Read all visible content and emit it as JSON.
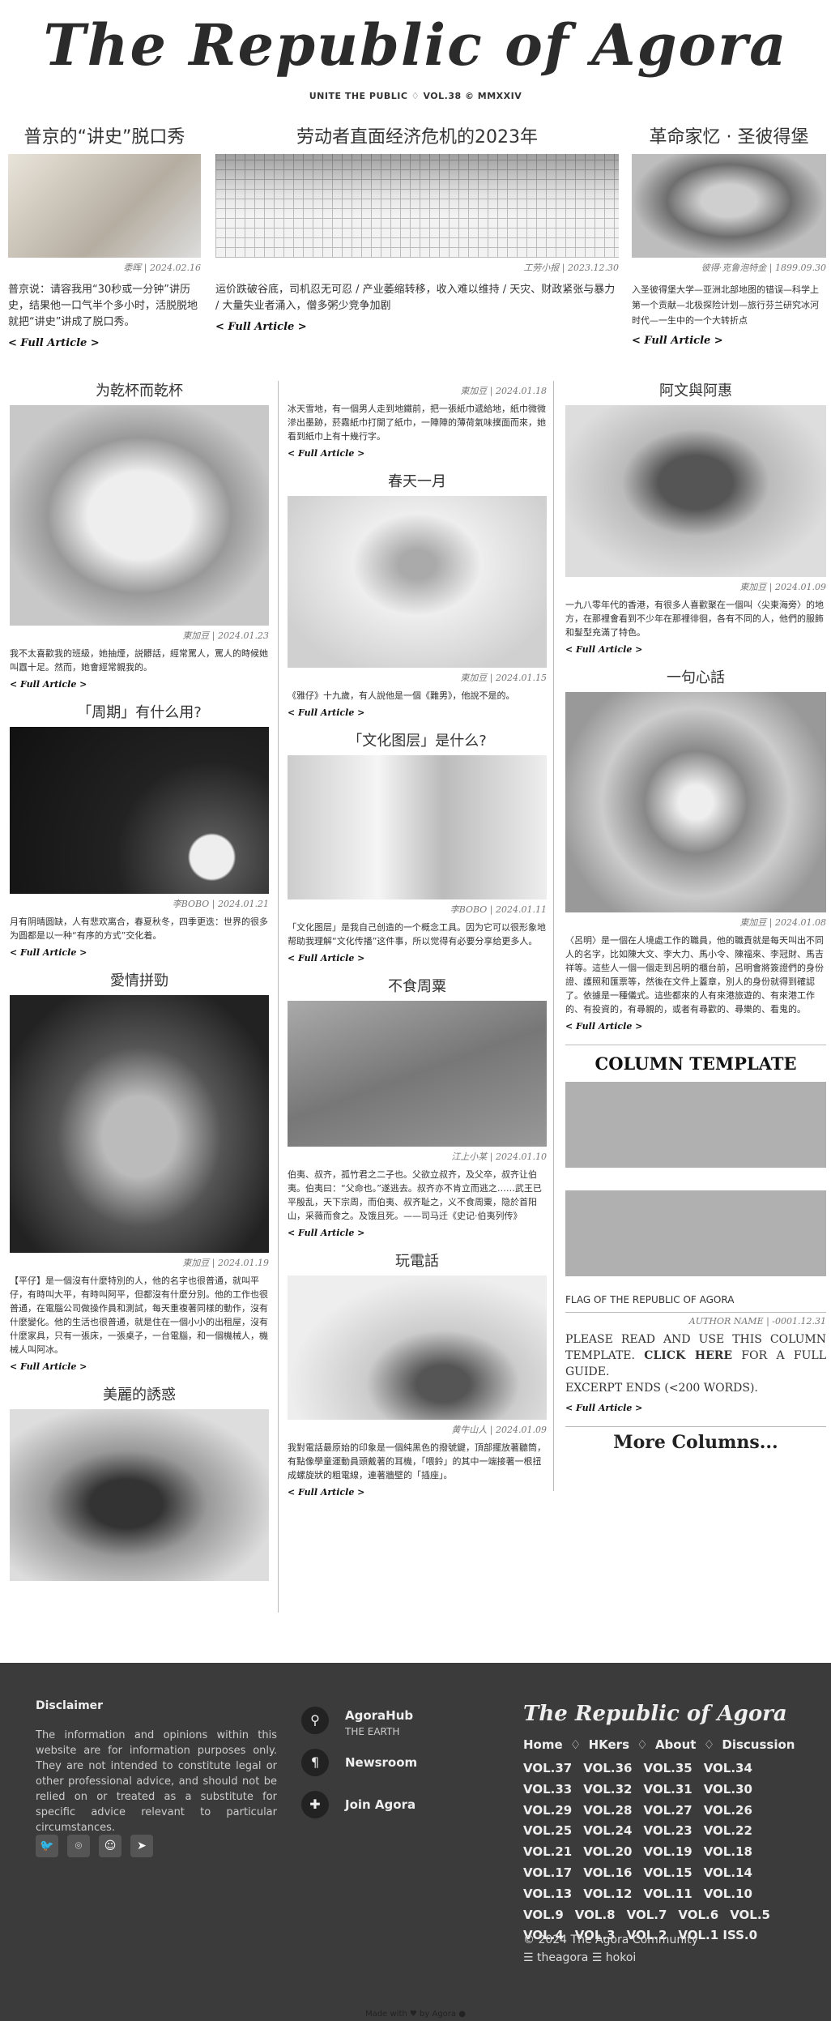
{
  "masthead": {
    "title": "The Republic of Agora",
    "subtitle": "UNITE THE PUBLIC ♢ VOL.38 © MMXXIV"
  },
  "top_articles": [
    {
      "title": "普京的“讲史”脱口秀",
      "meta": "黍晖 | 2024.02.16",
      "excerpt": "普京说：请容我用“30秒或一分钟”讲历史，结果他一口气半个多小时，活脱脱地就把“讲史”讲成了脱口秀。",
      "more": "< Full Article >"
    },
    {
      "title": "劳动者直面经济危机的2023年",
      "meta": "工劳小报 | 2023.12.30",
      "excerpt": "运价跌破谷底，司机忍无可忍 / 产业萎缩转移，收入难以维持 / 天灾、财政紧张与暴力 / 大量失业者涌入，僧多粥少竞争加剧",
      "more": "< Full Article >"
    },
    {
      "title": "革命家忆 · 圣彼得堡",
      "meta": "彼得·克鲁泡特金 | 1899.09.30",
      "excerpt": "入圣彼得堡大学—亚洲北部地图的错误—科学上第一个贡献—北极探险计划—旅行芬兰研究冰河时代—一生中的一个大转折点",
      "more": "< Full Article >"
    }
  ],
  "col_left": [
    {
      "title": "为乾杯而乾杯",
      "meta": "東加豆 | 2024.01.23",
      "excerpt": "我不太喜歡我的班級，她抽煙，説髒話，經常罵人，罵人的時候她叫囂十足。然而，她會經常親我的。",
      "more": "< Full Article >"
    },
    {
      "title": "「周期」有什么用?",
      "meta": "李BOBO | 2024.01.21",
      "excerpt": "月有阴晴圆缺，人有悲欢离合，春夏秋冬，四季更迭：世界的很多为圆都是以一种“有序的方式”交化着。",
      "more": "< Full Article >"
    },
    {
      "title": "愛情拼勁",
      "meta": "東加豆 | 2024.01.19",
      "excerpt": "【平仔】是一個沒有什麼特別的人，他的名字也很普通，就叫平仔，有時叫大平，有時叫阿平，但都沒有什麼分別。他的工作也很普通，在電腦公司做操作員和測試，每天重複著同樣的動作，沒有什麼變化。他的生活也很普通，就是住在一個小小的出租屋，沒有什麼家具，只有一張床，一張桌子，一台電腦，和一個機械人，機械人叫阿冰。",
      "more": "< Full Article >"
    },
    {
      "title": "美麗的誘惑",
      "meta": "",
      "excerpt": "",
      "more": ""
    }
  ],
  "col_mid": [
    {
      "title": "",
      "meta": "東加豆 | 2024.01.18",
      "excerpt": "冰天雪地，有一個男人走到地鐵前，把一張紙巾遞給地，紙巾微微滲出墨跡，菸霧紙巾打開了紙巾，一陣陣的薄荷氣味撲面而來，她看到紙巾上有十幾行字。",
      "more": "< Full Article >"
    },
    {
      "title": "春天一月",
      "meta": "東加豆 | 2024.01.15",
      "excerpt": "《雅仔》十九歲，有人說他是一個《難男》，他說不是的。",
      "more": "< Full Article >"
    },
    {
      "title": "「文化图层」是什么?",
      "meta": "李BOBO | 2024.01.11",
      "excerpt": "「文化图层」是我自己创造的一个概念工具。因为它可以很形象地帮助我理解“文化传播”这件事，所以觉得有必要分享给更多人。",
      "more": "< Full Article >"
    },
    {
      "title": "不食周粟",
      "meta": "江上小某 | 2024.01.10",
      "excerpt": "伯夷、叔齐，孤竹君之二子也。父欲立叔齐，及父卒，叔齐让伯夷。伯夷曰：“父命也。”遂逃去。叔齐亦不肯立而逃之……武王已平殷乱，天下宗周，而伯夷、叔齐耻之，义不食周粟，隐於首阳山，采薇而食之。及饿且死。——司马迁《史记·伯夷列传》",
      "more": "< Full Article >"
    },
    {
      "title": "玩電話",
      "meta": "黄牛山人 | 2024.01.09",
      "excerpt": "我對電話最原始的印象是一個純黑色的撥號鍵，頂部擺放著聽筒，有點像學童運動員頭戴著的耳機，「喂鈴」的其中一端接著一根扭成螺旋狀的粗電線，連著牆壁的「插座」。",
      "more": "< Full Article >"
    }
  ],
  "col_right": [
    {
      "title": "阿文與阿惠",
      "meta": "東加豆 | 2024.01.09",
      "excerpt": "一九八零年代的香港，有很多人喜歡聚在一個叫〈尖東海旁〉的地方，在那裡會看到不少年在那裡徘徊，各有不同的人，他們的服飾和髮型充滿了特色。",
      "more": "< Full Article >"
    },
    {
      "title": "一句心話",
      "meta": "東加豆 | 2024.01.08",
      "excerpt": "〈呂明〉是一個在人境處工作的職員，他的職責就是每天叫出不同人的名字，比如陳大文、李大力、馬小令、陳福來、李冠財、馬吉祥等。這些人一個一個走到呂明的櫃台前，呂明會將簽證們的身份證、護照和匯票等，然後在文件上蓋章，別人的身份就得到確認了。依據是一種儀式。這些都來的人有來港旅遊的、有來港工作的、有投資的，有尋親的，或者有尋歡的、尋樂的、看鬼的。",
      "more": "< Full Article >"
    }
  ],
  "template": {
    "title": "COLUMN TEMPLATE",
    "caption": "FLAG OF THE REPUBLIC OF AGORA",
    "meta": "AUTHOR NAME | -0001.12.31",
    "text_a": "PLEASE READ AND USE THIS COLUMN TEMPLATE.",
    "text_b": "CLICK HERE",
    "text_c": "FOR A FULL GUIDE.",
    "text_d": "EXCERPT ENDS (<200 WORDS).",
    "more": "< Full Article >"
  },
  "more_columns": "More Columns...",
  "footer": {
    "disclaimer_title": "Disclaimer",
    "disclaimer_text": "The information and opinions within this website are for information purposes only. They are not intended to constitute legal or other professional advice, and should not be relied on or treated as a substitute for specific advice relevant to particular circumstances.",
    "social_icons": [
      "twitter-icon",
      "github-icon",
      "reddit-icon",
      "telegram-icon"
    ],
    "links": [
      {
        "title": "AgoraHub",
        "sub": "THE EARTH",
        "icon": "map-pin-icon"
      },
      {
        "title": "Newsroom",
        "sub": "",
        "icon": "paragraph-icon"
      },
      {
        "title": "Join Agora",
        "sub": "",
        "icon": "puzzle-icon"
      }
    ],
    "brand": "The Republic of Agora",
    "nav": [
      "Home",
      "HKers",
      "About",
      "Discussion"
    ],
    "nav_sep": "♢",
    "vols": [
      "VOL.37",
      "VOL.36",
      "VOL.35",
      "VOL.34",
      "VOL.33",
      "VOL.32",
      "VOL.31",
      "VOL.30",
      "VOL.29",
      "VOL.28",
      "VOL.27",
      "VOL.26",
      "VOL.25",
      "VOL.24",
      "VOL.23",
      "VOL.22",
      "VOL.21",
      "VOL.20",
      "VOL.19",
      "VOL.18",
      "VOL.17",
      "VOL.16",
      "VOL.15",
      "VOL.14",
      "VOL.13",
      "VOL.12",
      "VOL.11",
      "VOL.10",
      "VOL.9",
      "VOL.8",
      "VOL.7",
      "VOL.6",
      "VOL.5",
      "VOL.4",
      "VOL.3",
      "VOL.2",
      "VOL.1 ISS.0"
    ],
    "copyright": "© 2024 The Agora Community",
    "bottom_links": "☰ theagora ☰ hokoi"
  },
  "made_with": "Made with ♥ by Agora ●"
}
